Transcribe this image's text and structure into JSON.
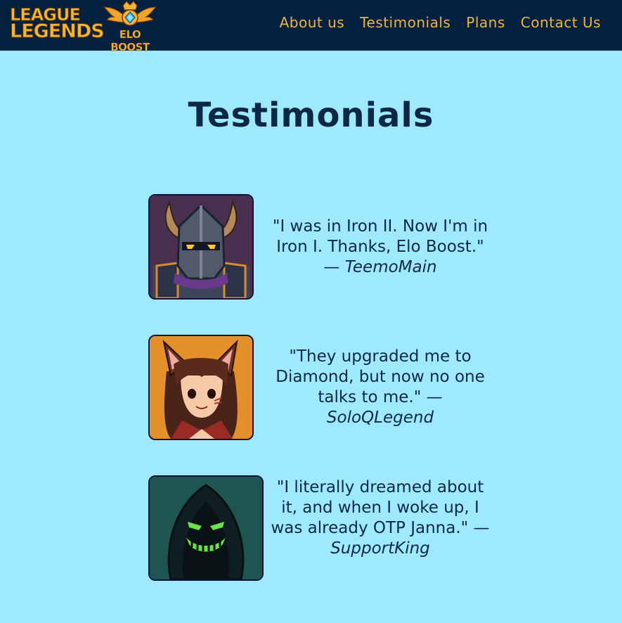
{
  "header": {
    "logo_lol_line1": "LEAGUE",
    "logo_lol_line2": "LEGENDS",
    "logo_elo_text": "ELO BOOST",
    "nav": [
      "About us",
      "Testimonials",
      "Plans",
      "Contact Us"
    ]
  },
  "page": {
    "title": "Testimonials"
  },
  "testimonials": [
    {
      "quote": "\"I was in Iron II. Now I'm in Iron I. Thanks, Elo Boost.\" —",
      "author": "TeemoMain",
      "avatar": "armored-knight-avatar-icon"
    },
    {
      "quote": "\"They upgraded me to Diamond, but now no one talks to me.\" —",
      "author": "SoloQLegend",
      "avatar": "fox-girl-avatar-icon"
    },
    {
      "quote": "\"I literally dreamed about it, and when I woke up, I was already OTP Janna.\" —",
      "author": "SupportKing",
      "avatar": "hooded-figure-avatar-icon"
    }
  ],
  "colors": {
    "navbar": "#04213f",
    "background": "#9eeafc",
    "accent": "#f2b33d",
    "text": "#0d2847"
  }
}
